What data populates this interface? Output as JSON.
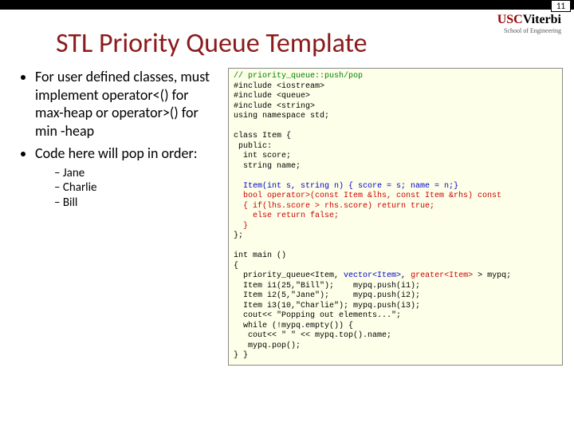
{
  "page_number": "11",
  "logo": {
    "usc": "USC",
    "viterbi": "Viterbi",
    "sub": "School of Engineering"
  },
  "title": "STL Priority Queue Template",
  "bullets": {
    "b1": "For user defined classes, must implement operator<() for max-heap or operator>() for min -heap",
    "b2": "Code here will pop in order:",
    "s1": "Jane",
    "s2": "Charlie",
    "s3": "Bill"
  },
  "code": {
    "c01": "// priority_queue::push/pop",
    "c02": "#include <iostream>",
    "c03": "#include <queue>",
    "c04": "#include <string>",
    "c05": "using namespace std;",
    "c06": "",
    "c07": "class Item {",
    "c08": " public:",
    "c09": "  int score;",
    "c10": "  string name;",
    "c11": "",
    "c12": "  Item(int s, string n) { score = s; name = n;}",
    "c13a": "  bool operator>(const Item &lhs, const Item &rhs) const",
    "c13b": "  { if(lhs.score > rhs.score) return true;",
    "c13c": "    else return false;",
    "c13d": "  }",
    "c14": "};",
    "c15": "",
    "c16": "int main ()",
    "c17": "{",
    "c18a": "  priority_queue<Item, ",
    "c18b": "vector<Item>",
    "c18c": ", ",
    "c18d": "greater<Item>",
    "c18e": " > mypq;",
    "c19": "  Item i1(25,\"Bill\");    mypq.push(i1);",
    "c20": "  Item i2(5,\"Jane\");     mypq.push(i2);",
    "c21": "  Item i3(10,\"Charlie\"); mypq.push(i3);",
    "c22": "  cout<< \"Popping out elements...\";",
    "c23": "  while (!mypq.empty()) {",
    "c24": "   cout<< \" \" << mypq.top().name;",
    "c25": "   mypq.pop();",
    "c26": "} }"
  }
}
